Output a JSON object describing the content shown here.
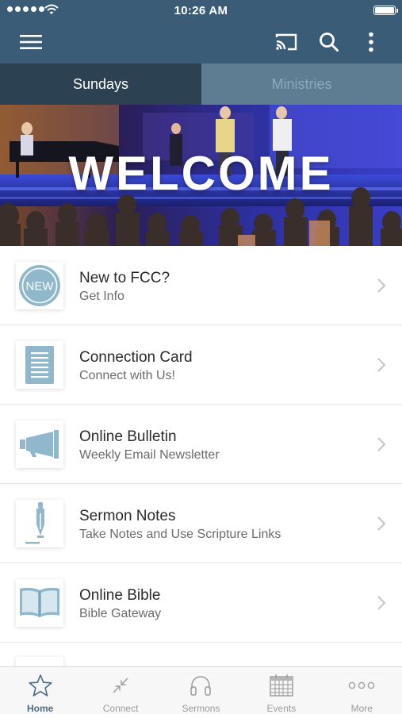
{
  "status_bar": {
    "time": "10:26 AM",
    "signal_icon": "signal-dots-icon",
    "wifi_icon": "wifi-icon",
    "battery_icon": "battery-icon",
    "battery_level": 1.0
  },
  "app_bar": {
    "menu_icon": "hamburger-menu-icon",
    "cast_icon": "cast-icon",
    "search_icon": "search-icon",
    "more_icon": "more-vertical-icon"
  },
  "tabs": [
    {
      "label": "Sundays",
      "active": true
    },
    {
      "label": "Ministries",
      "active": false
    }
  ],
  "hero": {
    "text": "WELCOME"
  },
  "menu_items": [
    {
      "icon": "new-badge-icon",
      "badge_text": "NEW",
      "title": "New to FCC?",
      "subtitle": "Get Info"
    },
    {
      "icon": "card-document-icon",
      "title": "Connection Card",
      "subtitle": "Connect with Us!"
    },
    {
      "icon": "megaphone-icon",
      "title": "Online Bulletin",
      "subtitle": "Weekly Email Newsletter"
    },
    {
      "icon": "pen-icon",
      "title": "Sermon Notes",
      "subtitle": "Take Notes and Use Scripture Links"
    },
    {
      "icon": "open-book-icon",
      "title": "Online Bible",
      "subtitle": "Bible Gateway"
    }
  ],
  "bottom_tabs": [
    {
      "label": "Home",
      "icon": "star-icon",
      "active": true
    },
    {
      "label": "Connect",
      "icon": "connect-arrows-icon",
      "active": false
    },
    {
      "label": "Sermons",
      "icon": "headphones-icon",
      "active": false
    },
    {
      "label": "Events",
      "icon": "calendar-icon",
      "active": false
    },
    {
      "label": "More",
      "icon": "more-horizontal-icon",
      "active": false
    }
  ],
  "colors": {
    "app_bar": "#3a5c76",
    "tab_active": "#2c4252",
    "tab_inactive": "#5e7d93",
    "icon_accent": "#8fb8cc",
    "active_tab_label": "#4a6d86"
  }
}
